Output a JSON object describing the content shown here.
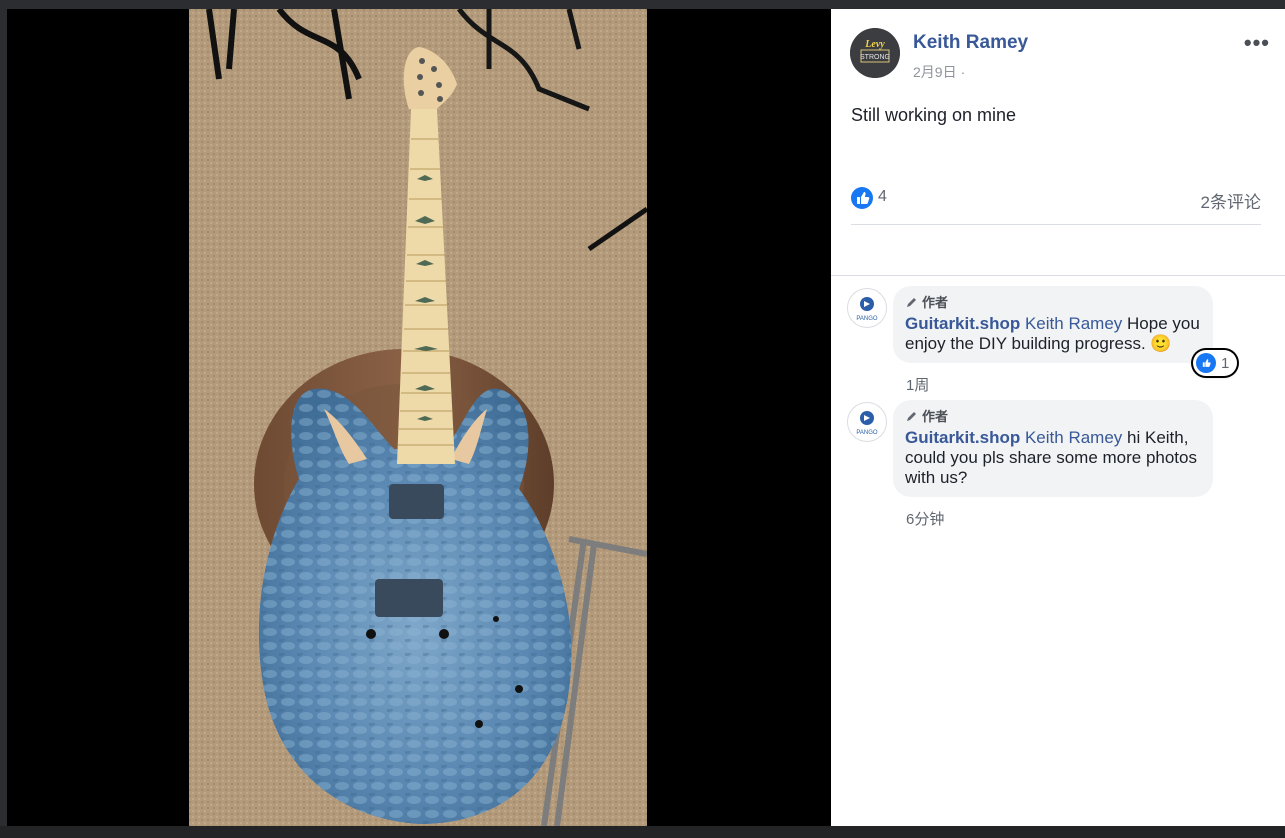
{
  "post": {
    "author": "Keith Ramey",
    "avatar_text_top": "Levy",
    "avatar_text_bottom": "STRONG",
    "time": "2月9日",
    "privacy_sep": "·",
    "text": "Still working on mine",
    "likes": "4",
    "comment_count": "2条评论",
    "more_label": "•••"
  },
  "colors": {
    "link": "#385898",
    "like_blue": "#1877f2",
    "panel_bg": "#ffffff",
    "bubble_bg": "#f2f3f5"
  },
  "comments": [
    {
      "badge": "作者",
      "author": "Guitarkit.shop",
      "mention": "Keith Ramey",
      "text": " Hope you enjoy the DIY building progress. 🙂",
      "time": "1周",
      "reactions": "1",
      "avatar_label": "PANGO"
    },
    {
      "badge": "作者",
      "author": "Guitarkit.shop",
      "mention": "Keith Ramey",
      "text": " hi Keith, could you pls share some more photos with us?",
      "time": "6分钟",
      "avatar_label": "PANGO"
    }
  ]
}
